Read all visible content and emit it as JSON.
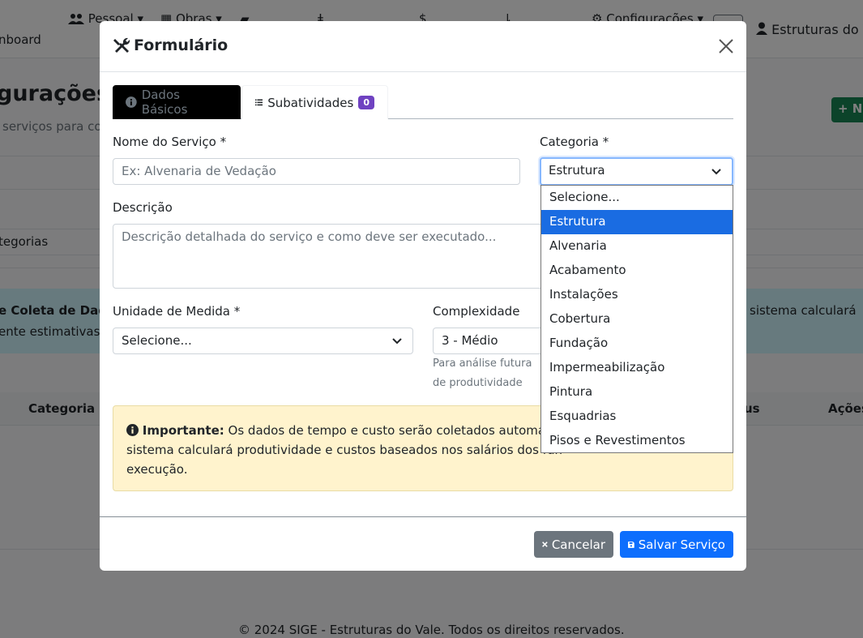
{
  "background": {
    "nav": {
      "dashboard": "nboard",
      "pessoal": "Pessoal",
      "obras": "Obras",
      "configuracoes": "Configurações",
      "user": "Estruturas do V"
    },
    "page_title": "gurações –",
    "page_subtitle": "serviços para col",
    "new_button": "+ N",
    "filter_label": "tegorias",
    "info": {
      "title": "e Coleta de Dado",
      "line2": "ente estimativas b",
      "right": "sistema calculará"
    },
    "table_headers": [
      "Categoria",
      "us",
      "Ações"
    ],
    "footer": "© 2024 SIGE - Estruturas do Vale. Todos os direitos reservados."
  },
  "modal": {
    "title": "Formulário",
    "tabs": [
      {
        "label": "Dados Básicos"
      },
      {
        "label": "Subatividades",
        "badge": "0"
      }
    ],
    "fields": {
      "nome_label": "Nome do Serviço *",
      "nome_placeholder": "Ex: Alvenaria de Vedação",
      "categoria_label": "Categoria *",
      "categoria_value": "Estrutura",
      "descricao_label": "Descrição",
      "descricao_placeholder": "Descrição detalhada do serviço e como deve ser executado...",
      "unidade_label": "Unidade de Medida *",
      "unidade_value": "Selecione...",
      "complexidade_label": "Complexidade",
      "complexidade_value": "3 - Médio",
      "complexidade_help": "Para análise futura de produtividade"
    },
    "alert": {
      "strong": "Importante:",
      "text": "Os dados de tempo e custo serão coletados automatica",
      "line2": "sistema calculará produtividade e custos baseados nos salários dos fun",
      "line3": "execução."
    },
    "buttons": {
      "cancel": "Cancelar",
      "save": "Salvar Serviço"
    }
  },
  "dropdown": {
    "options": [
      "Selecione...",
      "Estrutura",
      "Alvenaria",
      "Acabamento",
      "Instalações",
      "Cobertura",
      "Fundação",
      "Impermeabilização",
      "Pintura",
      "Esquadrias",
      "Pisos e Revestimentos"
    ],
    "selected": "Estrutura"
  },
  "colors": {
    "primary": "#0d6efd",
    "secondary": "#6c757d",
    "selected_option": "#1a6ce2",
    "alert_bg": "#fff3cd",
    "badge": "#6f42c1"
  }
}
